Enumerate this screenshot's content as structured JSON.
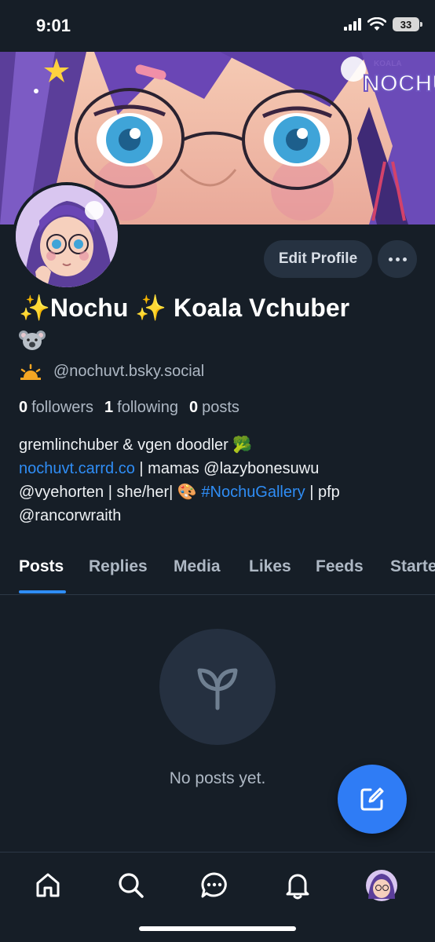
{
  "status_bar": {
    "time": "9:01",
    "battery": "33"
  },
  "profile": {
    "display_name": "✨Nochu ✨ Koala Vchuber",
    "name_emoji": "🐨",
    "handle_emoji": "🌥",
    "handle": "@nochuvt.bsky.social",
    "edit_profile_label": "Edit Profile",
    "banner_logo_text": "NOCHU",
    "banner_logo_small": "KOALA"
  },
  "stats": {
    "followers_count": "0",
    "followers_label": "followers",
    "following_count": "1",
    "following_label": "following",
    "posts_count": "0",
    "posts_label": "posts"
  },
  "bio": {
    "line1": "gremlinchuber & vgen doodler 🥦",
    "link1": "nochuvt.carrd.co",
    "text1": " | mamas @lazybonesuwu",
    "text2": "@vyehorten | she/her| 🎨 ",
    "hashtag": "#NochuGallery",
    "text3": " | pfp",
    "text4": "@rancorwraith"
  },
  "tabs": [
    {
      "label": "Posts"
    },
    {
      "label": "Replies"
    },
    {
      "label": "Media"
    },
    {
      "label": "Likes"
    },
    {
      "label": "Feeds"
    },
    {
      "label": "Starte"
    }
  ],
  "empty_state": {
    "text": "No posts yet.",
    "icon": "sprout-icon"
  },
  "colors": {
    "background": "#161e27",
    "accent": "#2f8df5",
    "button_bg": "#263241",
    "fab": "#2f7cf5"
  },
  "bottom_nav": [
    "home-icon",
    "search-icon",
    "chat-icon",
    "bell-icon",
    "profile-avatar"
  ]
}
